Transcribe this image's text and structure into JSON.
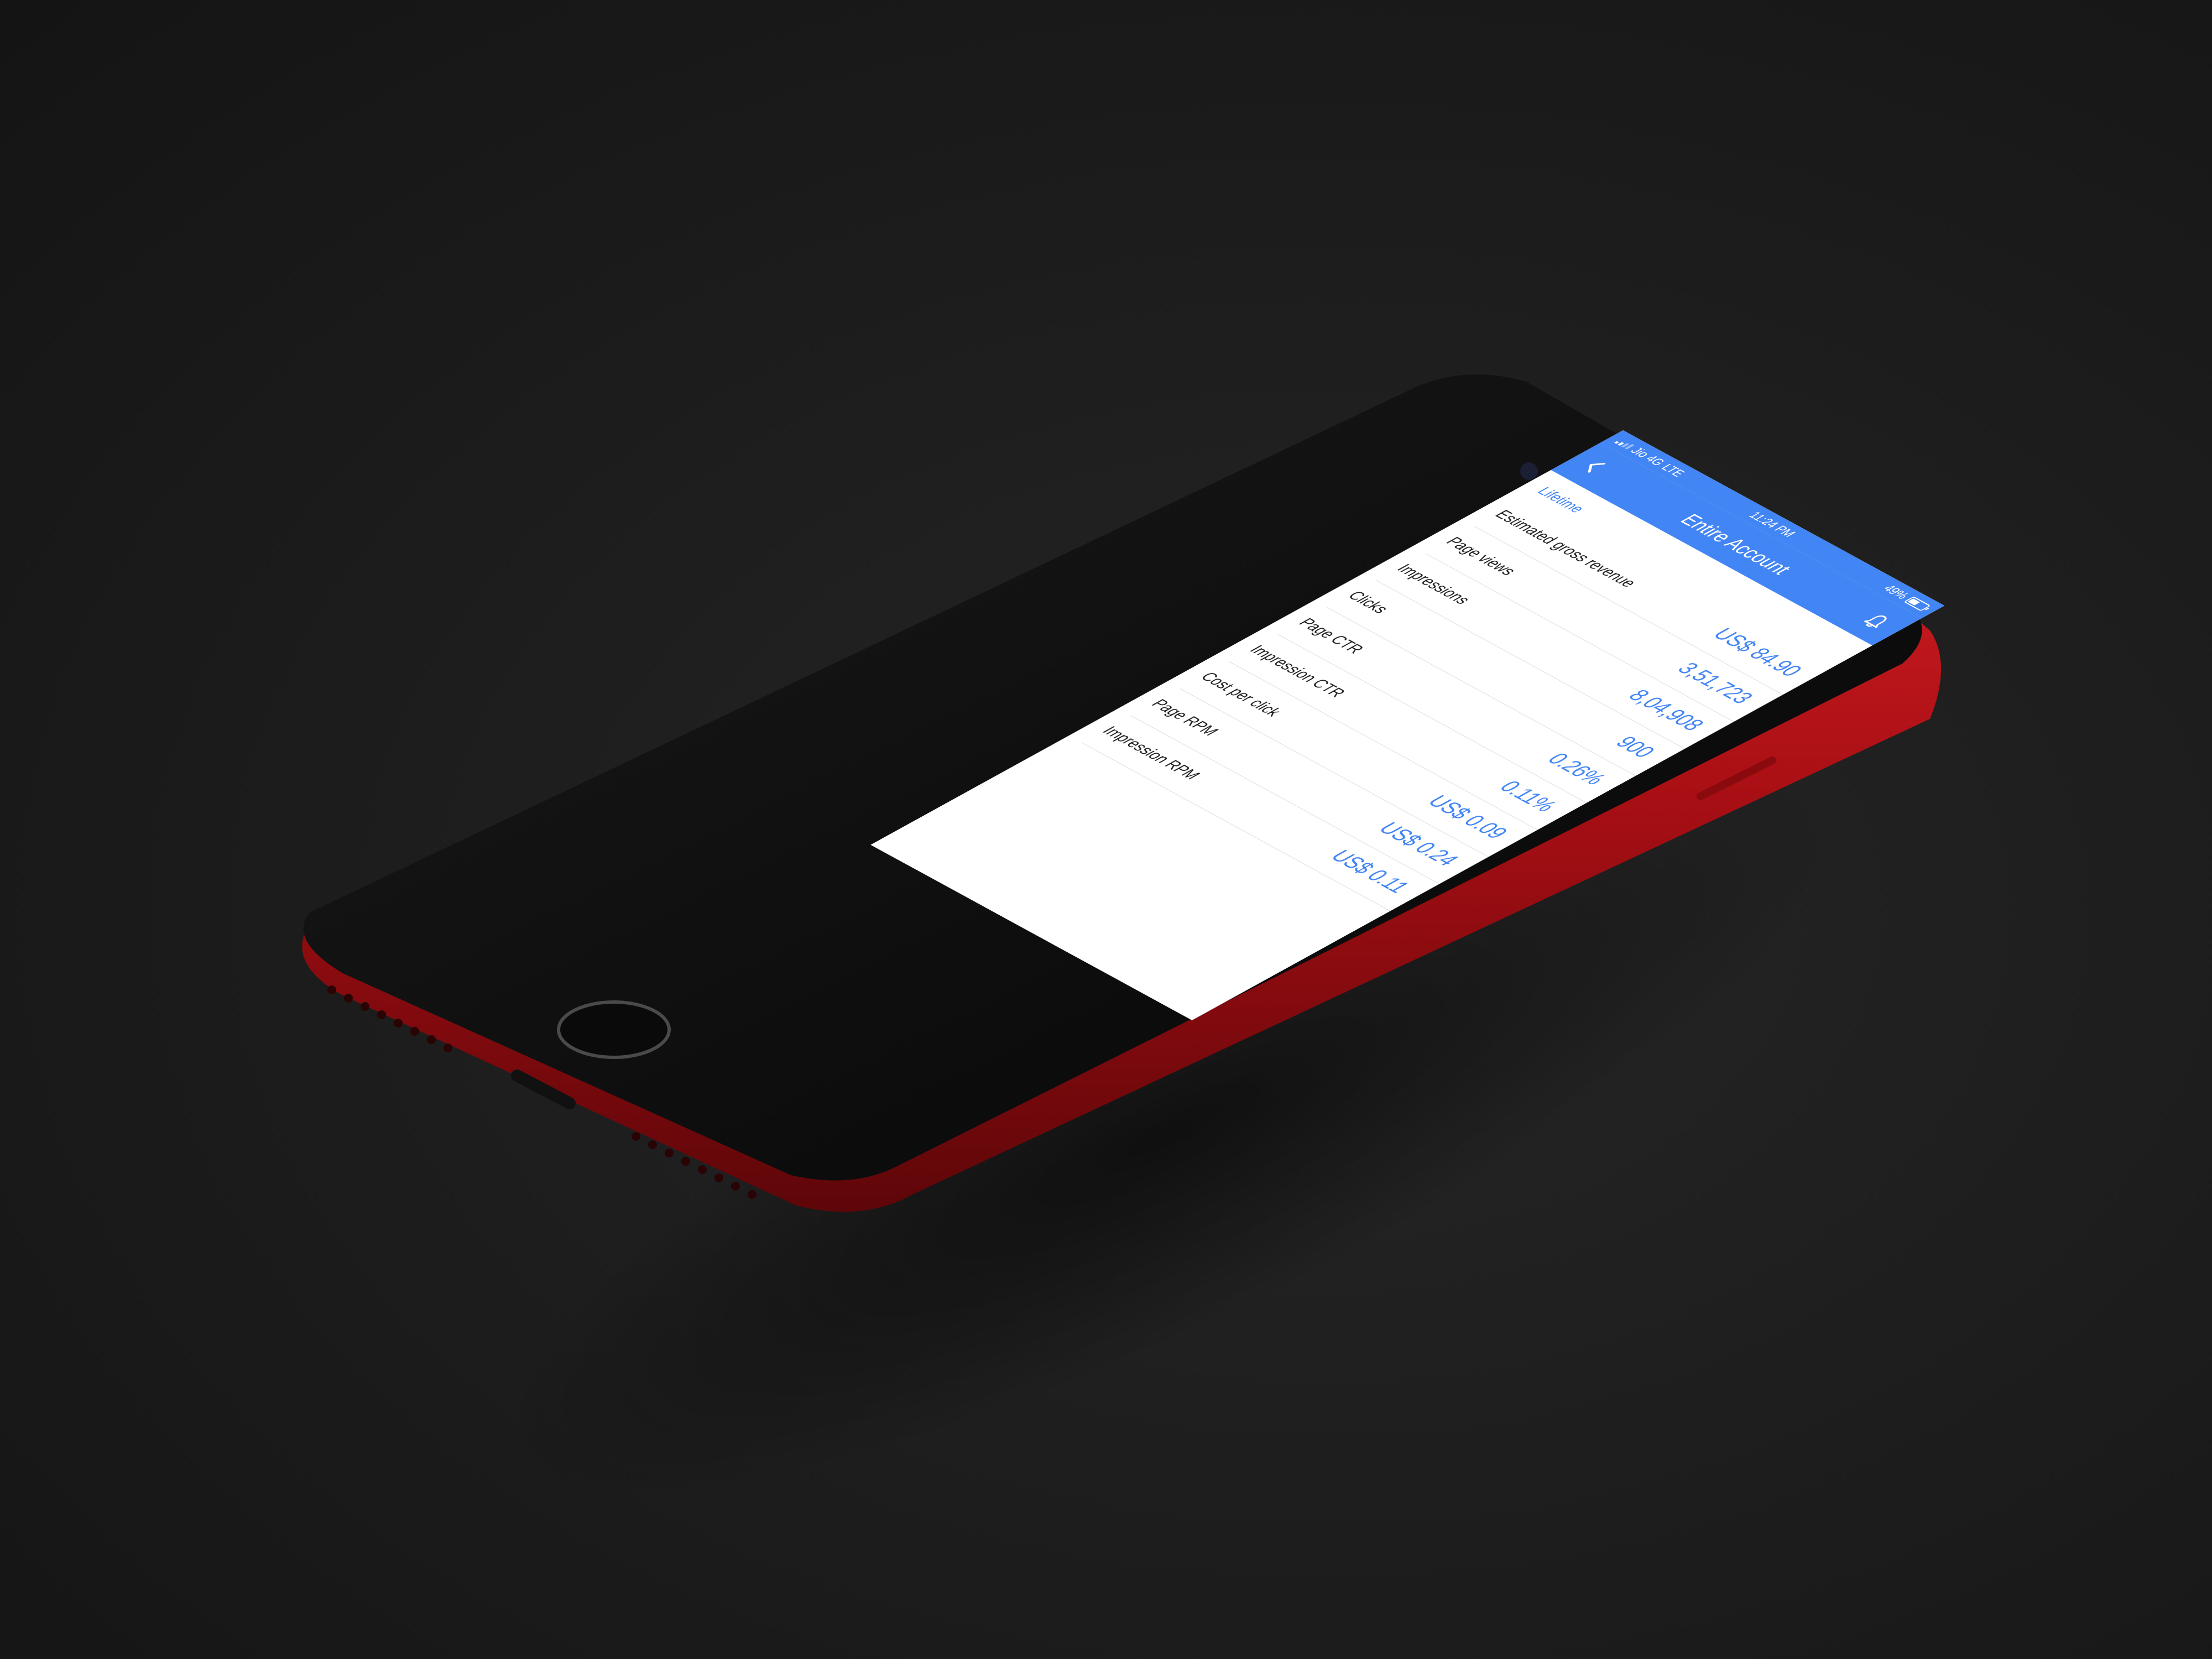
{
  "status_bar": {
    "carrier": "Jio 4G",
    "network": "LTE",
    "time": "11:24 PM",
    "battery": "49%"
  },
  "nav": {
    "title": "Entire Account",
    "back_icon": "chevron-left-icon",
    "bell_icon": "bell-icon"
  },
  "period_label": "Lifetime",
  "metrics": [
    {
      "label": "Estimated gross revenue",
      "value": "US$ 84.90"
    },
    {
      "label": "Page views",
      "value": "3,51,723"
    },
    {
      "label": "Impressions",
      "value": "8,04,908"
    },
    {
      "label": "Clicks",
      "value": "900"
    },
    {
      "label": "Page CTR",
      "value": "0.26%"
    },
    {
      "label": "Impression CTR",
      "value": "0.11%"
    },
    {
      "label": "Cost per click",
      "value": "US$ 0.09"
    },
    {
      "label": "Page RPM",
      "value": "US$ 0.24"
    },
    {
      "label": "Impression RPM",
      "value": "US$ 0.11"
    }
  ],
  "colors": {
    "accent": "#4285f4",
    "phone_body": "#c4161c",
    "bezel": "#0d0d0d"
  }
}
